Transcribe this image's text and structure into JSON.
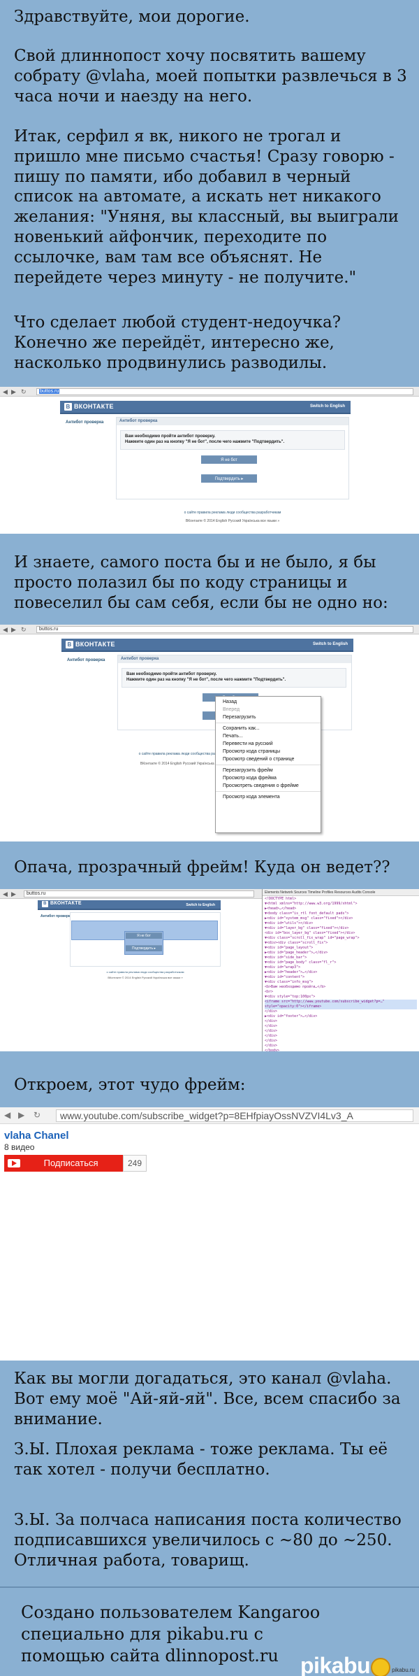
{
  "texts": {
    "p1": "Здравствуйте, мои дорогие.",
    "p2": "Свой длиннопост хочу посвятить вашему собрату @vlaha, моей попытки развлечься в 3 часа ночи и наезду на него.",
    "p3": "Итак, серфил я вк, никого не трогал и пришло мне письмо счастья! Сразу говорю - пишу по памяти, ибо добавил в черный список на автомате, а искать нет никакого желания: \"Уняня, вы классный, вы выиграли новенький айфончик, переходите по ссылочке, вам там все объяснят. Не перейдете через минуту - не получите.\"",
    "p4": "Что сделает любой студент-недоучка? Конечно же перейдёт, интересно же, насколько продвинулись разводилы.",
    "p5": "И знаете, самого поста бы и не было, я бы просто полазил бы по коду страницы и повеселил бы сам себя, если бы не одно но:",
    "p6": "Опача, прозрачный фрейм! Куда он ведет??",
    "p7": "Откроем, этот чудо фрейм:",
    "p8": "Как вы могли догадаться, это канал @vlaha. Вот ему моё \"Ай-яй-яй\". Все, всем спасибо за внимание.",
    "p9": "З.Ы. Плохая реклама - тоже реклама. Ты её так хотел - получи бесплатно.",
    "p10": "З.Ы. За полчаса написания поста количество подписавшихся увеличилось с ~80 до ~250. Отличная работа, товарищ.",
    "footer": "Создано пользователем Kangaroo специально для pikabu.ru с помощью сайта dlinnopost.ru",
    "brand": "pikabu",
    "watermark": "pikabu.ru"
  },
  "shot1": {
    "url": "buttos.ru",
    "logo": "ВКОНТАКТЕ",
    "english": "Switch to English",
    "side": "Антибот проверка",
    "panel_title": "Антибот проверка",
    "box_line1": "Вам необходимо пройти антибот проверку.",
    "box_line2": "Нажмите один раз на кнопку \"Я не бот\", после чего нажмите \"Подтвердить\".",
    "btn1": "Я не бот",
    "btn2": "Подтвердить  ▸",
    "foot1": "о сайте   правила   реклама   люди   сообщества   разработчикам",
    "foot2": "ВКонтакте © 2014   English   Русский   Українська   все языки »"
  },
  "shot2": {
    "url": "buttos.ru",
    "menu": [
      "Назад",
      "Вперед",
      "Перезагрузить",
      "Сохранить как...",
      "Печать...",
      "Перевести на русский",
      "Просмотр кода страницы",
      "Просмотр сведений о странице",
      "Перезагрузить фрейм",
      "Просмотр кода фрейма",
      "Просмотреть сведения о фрейме",
      "Просмотр кода элемента"
    ]
  },
  "shot3": {
    "url": "buttos.ru",
    "dev_tabs": "Elements  Network  Sources  Timeline  Profiles  Resources  Audits  Console",
    "code_lines": [
      "<!DOCTYPE html>",
      "▼<html xmlns=\"http://www.w3.org/1999/xhtml\">",
      " ▶<head>…</head>",
      " ▼<body class=\"is_rtl font_default pads\">",
      "  ▶<div id=\"system_msg\" class=\"fixed\"></div>",
      "  ▼<div id=\"utils\"></div>",
      "   ▼<div id=\"layer_bg\" class=\"fixed\"></div>",
      "    <div id=\"box_layer_bg\" class=\"fixed\"></div>",
      "   ▼<div class=\"scroll_fix_wrap\" id=\"page_wrap\">",
      "    ▼<div><div class=\"scroll_fix\">",
      "     ▼<div id=\"page_layout\">",
      "      ▶<div id=\"page_header\">…</div>",
      "      ▼<div id=\"side_bar\">",
      "       ▼<div id=\"page_body\" class=\"fl_r\">",
      "        ▼<div id=\"wrap3\">",
      "         ▶<div id=\"header\">…</div>",
      "         ▼<div id=\"content\">",
      "          ▼<div class=\"info_msg\">",
      "           <b>Вам необходимо пройти…</b>",
      "           <br>",
      "          ▼<div style=\"top:100px\">",
      "            <iframe src=\"http://www.youtube.com/subscribe_widget?p=…\"",
      "             style=\"opacity:0\"></iframe>",
      "          </div>",
      "         ▶<div id=\"footer\">…</div>",
      "        </div>",
      "       </div>",
      "      </div>",
      "     </div>",
      "    </div>",
      "   </div>",
      "  </body>",
      "</html>"
    ]
  },
  "shot4": {
    "url": "www.youtube.com/subscribe_widget?p=8EHfpiayOssNVZVI4Lv3_A",
    "channel": "vlaha Chanel",
    "videos": "8 видео",
    "subscribe": "Подписаться",
    "count": "249"
  },
  "colors": {
    "background": "#8ab0d2",
    "vk_blue": "#4e73a0",
    "yt_red": "#e62117"
  }
}
